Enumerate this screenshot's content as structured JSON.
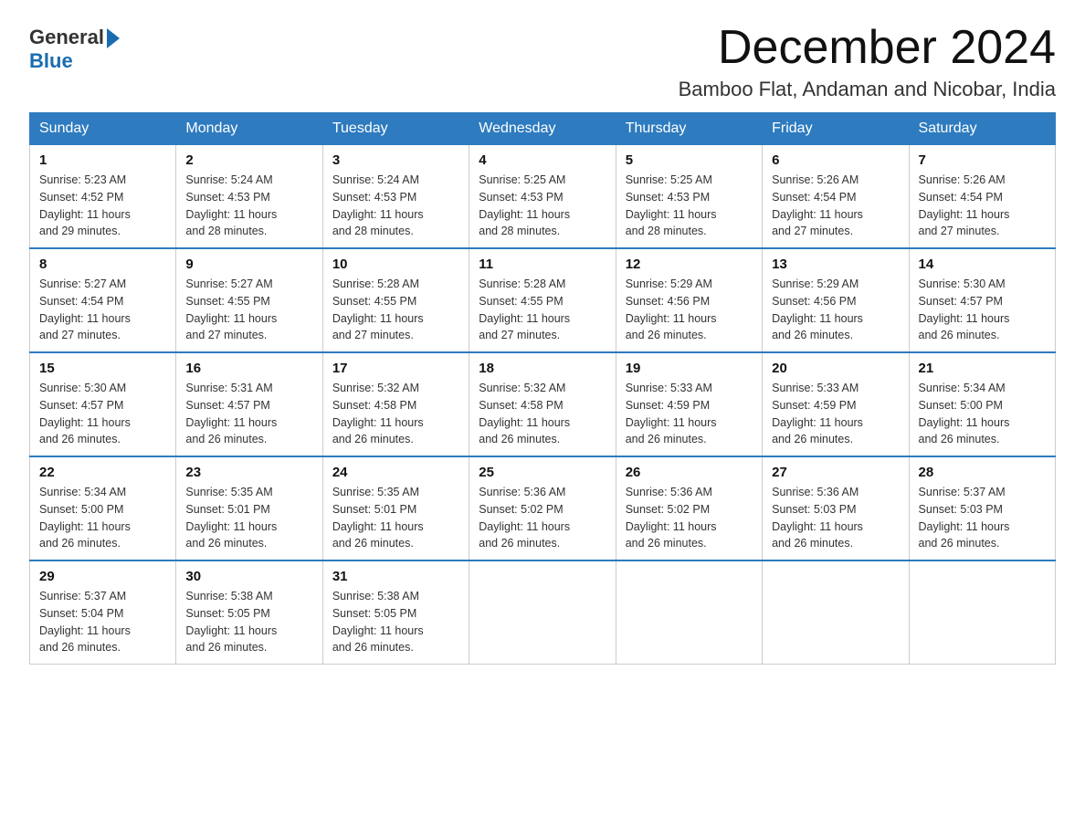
{
  "logo": {
    "general": "General",
    "arrow": "▶",
    "blue": "Blue"
  },
  "title": "December 2024",
  "subtitle": "Bamboo Flat, Andaman and Nicobar, India",
  "days_of_week": [
    "Sunday",
    "Monday",
    "Tuesday",
    "Wednesday",
    "Thursday",
    "Friday",
    "Saturday"
  ],
  "weeks": [
    [
      {
        "day": "1",
        "sunrise": "5:23 AM",
        "sunset": "4:52 PM",
        "daylight": "11 hours and 29 minutes."
      },
      {
        "day": "2",
        "sunrise": "5:24 AM",
        "sunset": "4:53 PM",
        "daylight": "11 hours and 28 minutes."
      },
      {
        "day": "3",
        "sunrise": "5:24 AM",
        "sunset": "4:53 PM",
        "daylight": "11 hours and 28 minutes."
      },
      {
        "day": "4",
        "sunrise": "5:25 AM",
        "sunset": "4:53 PM",
        "daylight": "11 hours and 28 minutes."
      },
      {
        "day": "5",
        "sunrise": "5:25 AM",
        "sunset": "4:53 PM",
        "daylight": "11 hours and 28 minutes."
      },
      {
        "day": "6",
        "sunrise": "5:26 AM",
        "sunset": "4:54 PM",
        "daylight": "11 hours and 27 minutes."
      },
      {
        "day": "7",
        "sunrise": "5:26 AM",
        "sunset": "4:54 PM",
        "daylight": "11 hours and 27 minutes."
      }
    ],
    [
      {
        "day": "8",
        "sunrise": "5:27 AM",
        "sunset": "4:54 PM",
        "daylight": "11 hours and 27 minutes."
      },
      {
        "day": "9",
        "sunrise": "5:27 AM",
        "sunset": "4:55 PM",
        "daylight": "11 hours and 27 minutes."
      },
      {
        "day": "10",
        "sunrise": "5:28 AM",
        "sunset": "4:55 PM",
        "daylight": "11 hours and 27 minutes."
      },
      {
        "day": "11",
        "sunrise": "5:28 AM",
        "sunset": "4:55 PM",
        "daylight": "11 hours and 27 minutes."
      },
      {
        "day": "12",
        "sunrise": "5:29 AM",
        "sunset": "4:56 PM",
        "daylight": "11 hours and 26 minutes."
      },
      {
        "day": "13",
        "sunrise": "5:29 AM",
        "sunset": "4:56 PM",
        "daylight": "11 hours and 26 minutes."
      },
      {
        "day": "14",
        "sunrise": "5:30 AM",
        "sunset": "4:57 PM",
        "daylight": "11 hours and 26 minutes."
      }
    ],
    [
      {
        "day": "15",
        "sunrise": "5:30 AM",
        "sunset": "4:57 PM",
        "daylight": "11 hours and 26 minutes."
      },
      {
        "day": "16",
        "sunrise": "5:31 AM",
        "sunset": "4:57 PM",
        "daylight": "11 hours and 26 minutes."
      },
      {
        "day": "17",
        "sunrise": "5:32 AM",
        "sunset": "4:58 PM",
        "daylight": "11 hours and 26 minutes."
      },
      {
        "day": "18",
        "sunrise": "5:32 AM",
        "sunset": "4:58 PM",
        "daylight": "11 hours and 26 minutes."
      },
      {
        "day": "19",
        "sunrise": "5:33 AM",
        "sunset": "4:59 PM",
        "daylight": "11 hours and 26 minutes."
      },
      {
        "day": "20",
        "sunrise": "5:33 AM",
        "sunset": "4:59 PM",
        "daylight": "11 hours and 26 minutes."
      },
      {
        "day": "21",
        "sunrise": "5:34 AM",
        "sunset": "5:00 PM",
        "daylight": "11 hours and 26 minutes."
      }
    ],
    [
      {
        "day": "22",
        "sunrise": "5:34 AM",
        "sunset": "5:00 PM",
        "daylight": "11 hours and 26 minutes."
      },
      {
        "day": "23",
        "sunrise": "5:35 AM",
        "sunset": "5:01 PM",
        "daylight": "11 hours and 26 minutes."
      },
      {
        "day": "24",
        "sunrise": "5:35 AM",
        "sunset": "5:01 PM",
        "daylight": "11 hours and 26 minutes."
      },
      {
        "day": "25",
        "sunrise": "5:36 AM",
        "sunset": "5:02 PM",
        "daylight": "11 hours and 26 minutes."
      },
      {
        "day": "26",
        "sunrise": "5:36 AM",
        "sunset": "5:02 PM",
        "daylight": "11 hours and 26 minutes."
      },
      {
        "day": "27",
        "sunrise": "5:36 AM",
        "sunset": "5:03 PM",
        "daylight": "11 hours and 26 minutes."
      },
      {
        "day": "28",
        "sunrise": "5:37 AM",
        "sunset": "5:03 PM",
        "daylight": "11 hours and 26 minutes."
      }
    ],
    [
      {
        "day": "29",
        "sunrise": "5:37 AM",
        "sunset": "5:04 PM",
        "daylight": "11 hours and 26 minutes."
      },
      {
        "day": "30",
        "sunrise": "5:38 AM",
        "sunset": "5:05 PM",
        "daylight": "11 hours and 26 minutes."
      },
      {
        "day": "31",
        "sunrise": "5:38 AM",
        "sunset": "5:05 PM",
        "daylight": "11 hours and 26 minutes."
      },
      null,
      null,
      null,
      null
    ]
  ],
  "labels": {
    "sunrise": "Sunrise:",
    "sunset": "Sunset:",
    "daylight": "Daylight:"
  }
}
